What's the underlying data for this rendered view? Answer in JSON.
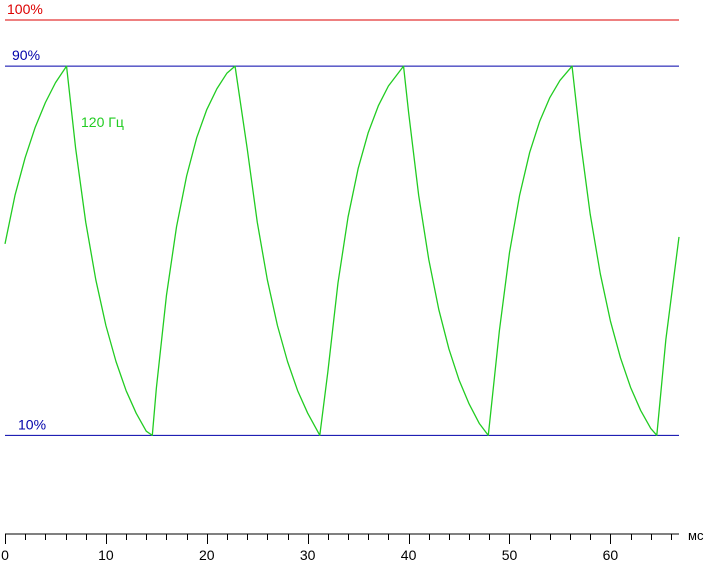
{
  "chart_data": {
    "type": "line",
    "title": "",
    "xlabel": "",
    "ylabel": "",
    "x_unit": "мс",
    "xlim": [
      0,
      66.8
    ],
    "ylim": [
      0,
      100
    ],
    "x_ticks": [
      0,
      10,
      20,
      30,
      40,
      50,
      60
    ],
    "x_tick_labels": [
      "0",
      "10",
      "20",
      "30",
      "40",
      "50",
      "60"
    ],
    "x_minor_tick_step": 2,
    "grid": false,
    "reference_lines": [
      {
        "value": 100,
        "label": "100%",
        "color": "#dd0000"
      },
      {
        "value": 90,
        "label": "90%",
        "color": "#0000aa"
      },
      {
        "value": 10,
        "label": "10%",
        "color": "#0000aa"
      }
    ],
    "series": [
      {
        "name": "120 Гц",
        "color": "#22cc22",
        "x": [
          0,
          1,
          2,
          3,
          4,
          5,
          6.1,
          7,
          8,
          9,
          10,
          11,
          12,
          13,
          14,
          14.6,
          15,
          16,
          17,
          18,
          19,
          20,
          21,
          22,
          22.8,
          24,
          25,
          26,
          27,
          28,
          29,
          30,
          31.2,
          32,
          33,
          34,
          35,
          36,
          37,
          38,
          39.5,
          40,
          41,
          42,
          43,
          44,
          45,
          46,
          47,
          47.9,
          49,
          50,
          51,
          52,
          53,
          54,
          55,
          56.2,
          57,
          58,
          59,
          60,
          61,
          62,
          63,
          64,
          64.6,
          65.5,
          66.8
        ],
        "values": [
          51.5,
          62.1,
          70.2,
          76.8,
          82.1,
          86.4,
          90.0,
          72.2,
          56.2,
          43.7,
          33.8,
          26.0,
          19.7,
          14.8,
          10.9,
          10.0,
          20.2,
          40.3,
          55.2,
          66.2,
          74.5,
          80.6,
          85.1,
          88.5,
          90.0,
          72.2,
          56.2,
          43.7,
          33.8,
          26.0,
          19.7,
          14.8,
          10.0,
          23.8,
          43.0,
          57.3,
          67.8,
          75.6,
          81.4,
          85.7,
          90.0,
          80.0,
          62.0,
          48.1,
          37.2,
          28.7,
          22.0,
          16.8,
          12.6,
          10.0,
          32.7,
          49.6,
          62.0,
          71.3,
          78.1,
          83.2,
          86.9,
          90.0,
          74.4,
          57.9,
          45.0,
          34.8,
          26.8,
          20.4,
          15.4,
          11.5,
          10.0,
          30.8,
          53.0
        ]
      }
    ]
  }
}
